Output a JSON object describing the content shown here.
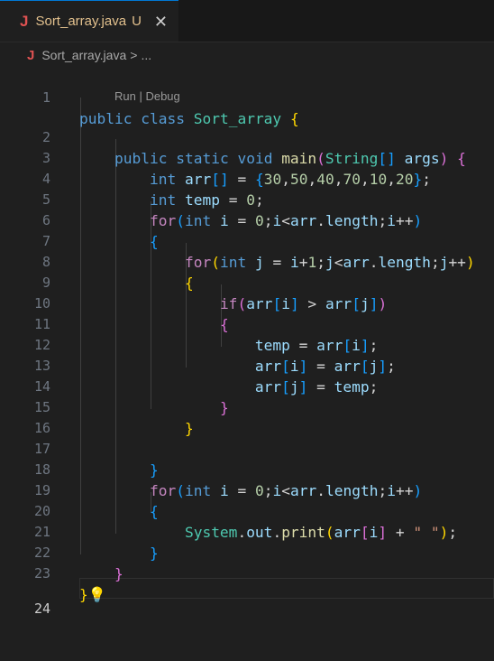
{
  "tab": {
    "icon": "J",
    "title": "Sort_array.java",
    "modified": "U",
    "close": "✕"
  },
  "breadcrumb": {
    "icon": "J",
    "file": "Sort_array.java",
    "sep": ">",
    "more": "..."
  },
  "codelens": "Run | Debug",
  "line_numbers": [
    "1",
    "2",
    "3",
    "4",
    "5",
    "6",
    "7",
    "8",
    "9",
    "10",
    "11",
    "12",
    "13",
    "14",
    "15",
    "16",
    "17",
    "18",
    "19",
    "20",
    "21",
    "22",
    "23",
    "24"
  ],
  "tokens": {
    "public": "public",
    "class": "class",
    "class_name": "Sort_array",
    "static": "static",
    "void": "void",
    "main": "main",
    "String": "String",
    "args": "args",
    "int": "int",
    "arr": "arr",
    "temp": "temp",
    "for": "for",
    "if": "if",
    "i": "i",
    "j": "j",
    "length": "length",
    "System": "System",
    "out": "out",
    "print": "print",
    "n0": "0",
    "n1": "1",
    "nums": [
      "30",
      "50",
      "40",
      "70",
      "10",
      "20"
    ],
    "space_str": "\" \""
  },
  "colors": {
    "keyword": "#569cd6",
    "control": "#c586c0",
    "type": "#4ec9b0",
    "function": "#dcdcaa",
    "variable": "#9cdcfe",
    "number": "#b5cea8",
    "string": "#ce9178"
  }
}
